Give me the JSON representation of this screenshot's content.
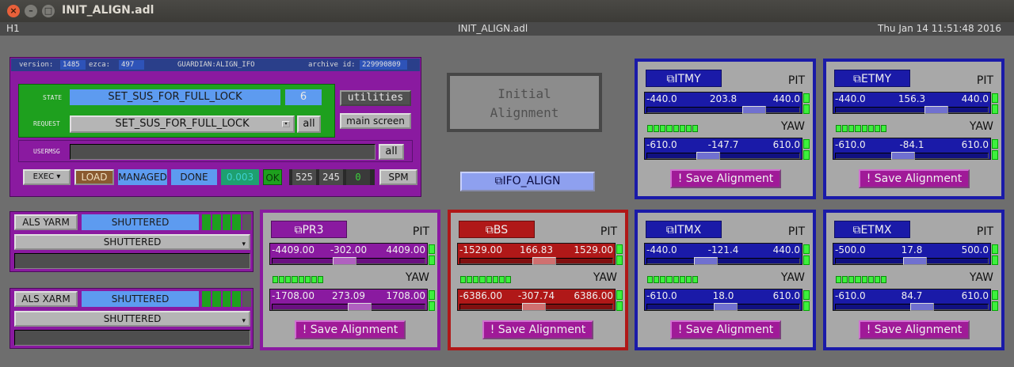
{
  "window": {
    "title": "INIT_ALIGN.adl",
    "close": "×",
    "min": "–",
    "max": "□"
  },
  "topbar": {
    "left": "H1",
    "center": "INIT_ALIGN.adl",
    "right": "Thu Jan 14 11:51:48 2016"
  },
  "guardian": {
    "version_label": "version:",
    "version": "1485",
    "ezca_label": "ezca:",
    "ezca": "497",
    "name": "GUARDIAN:ALIGN_IFO",
    "archive_label": "archive id:",
    "archive": "229990809",
    "state_label": "STATE",
    "state": "SET_SUS_FOR_FULL_LOCK",
    "state_index": "6",
    "request_label": "REQUEST",
    "request": "SET_SUS_FOR_FULL_LOCK",
    "request_all": "all",
    "utilities": "utilities",
    "main_screen": "main screen",
    "usermsg_label": "USERMSG",
    "usermsg_all": "all",
    "exec": "EXEC",
    "load": "LOAD",
    "managed": "MANAGED",
    "done": "DONE",
    "timer": "0.003",
    "ok": "OK",
    "n1": "525",
    "n2": "245",
    "n3": "0",
    "spm": "SPM"
  },
  "als_yarm": {
    "label": "ALS YARM",
    "state": "SHUTTERED",
    "select": "SHUTTERED"
  },
  "als_xarm": {
    "label": "ALS XARM",
    "state": "SHUTTERED",
    "select": "SHUTTERED"
  },
  "center": {
    "title_line1": "Initial",
    "title_line2": "Alignment",
    "ifo_button": "IFO_ALIGN"
  },
  "optics": {
    "pr3": {
      "name": "PR3",
      "pit_label": "PIT",
      "yaw_label": "YAW",
      "save": "Save Alignment",
      "pit": {
        "min": "-4409.00",
        "value": "-302.00",
        "max": "4409.00",
        "frac": 0.466
      },
      "yaw": {
        "min": "-1708.00",
        "value": "273.09",
        "max": "1708.00",
        "frac": 0.58
      }
    },
    "bs": {
      "name": "BS",
      "pit_label": "PIT",
      "yaw_label": "YAW",
      "save": "Save Alignment",
      "pit": {
        "min": "-1529.00",
        "value": "166.83",
        "max": "1529.00",
        "frac": 0.555
      },
      "yaw": {
        "min": "-6386.00",
        "value": "-307.74",
        "max": "6386.00",
        "frac": 0.476
      }
    },
    "itmy": {
      "name": "ITMY",
      "pit_label": "PIT",
      "yaw_label": "YAW",
      "save": "Save Alignment",
      "pit": {
        "min": "-440.0",
        "value": "203.8",
        "max": "440.0",
        "frac": 0.73
      },
      "yaw": {
        "min": "-610.0",
        "value": "-147.7",
        "max": "610.0",
        "frac": 0.38
      }
    },
    "etmy": {
      "name": "ETMY",
      "pit_label": "PIT",
      "yaw_label": "YAW",
      "save": "Save Alignment",
      "pit": {
        "min": "-440.0",
        "value": "156.3",
        "max": "440.0",
        "frac": 0.68
      },
      "yaw": {
        "min": "-610.0",
        "value": "-84.1",
        "max": "610.0",
        "frac": 0.43
      }
    },
    "itmx": {
      "name": "ITMX",
      "pit_label": "PIT",
      "yaw_label": "YAW",
      "save": "Save Alignment",
      "pit": {
        "min": "-440.0",
        "value": "-121.4",
        "max": "440.0",
        "frac": 0.36
      },
      "yaw": {
        "min": "-610.0",
        "value": "18.0",
        "max": "610.0",
        "frac": 0.51
      }
    },
    "etmx": {
      "name": "ETMX",
      "pit_label": "PIT",
      "yaw_label": "YAW",
      "save": "Save Alignment",
      "pit": {
        "min": "-500.0",
        "value": "17.8",
        "max": "500.0",
        "frac": 0.52
      },
      "yaw": {
        "min": "-610.0",
        "value": "84.7",
        "max": "610.0",
        "frac": 0.57
      }
    }
  },
  "colors": {
    "purple": "#8a1aa0",
    "red": "#b01818",
    "blue": "#1a1aa8",
    "guardian_green": "#1ea01e",
    "field_blue": "#5d9bf0",
    "led_green": "#3df03d"
  }
}
